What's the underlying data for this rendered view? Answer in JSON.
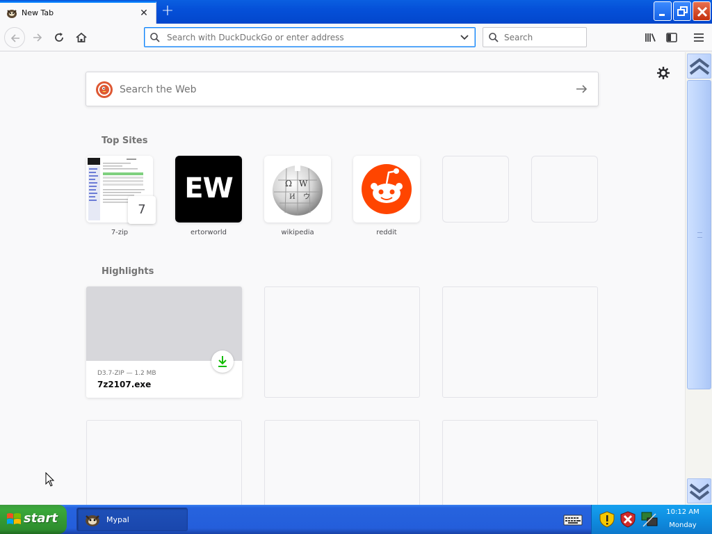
{
  "window": {
    "tab_title": "New Tab",
    "tab_close_glyph": "✕",
    "new_tab_glyph": "+"
  },
  "toolbar": {
    "url_placeholder": "Search with DuckDuckGo or enter address",
    "search_placeholder": "Search",
    "icons": [
      "back-icon",
      "forward-icon",
      "reload-icon",
      "home-icon",
      "library-icon",
      "sidebar-icon",
      "menu-icon"
    ]
  },
  "newtab": {
    "web_search_placeholder": "Search the Web",
    "top_sites_title": "Top Sites",
    "highlights_title": "Highlights",
    "top_sites": [
      {
        "label": "7-zip",
        "badge": "7"
      },
      {
        "label": "ertorworld",
        "logo_text": "EW"
      },
      {
        "label": "wikipedia"
      },
      {
        "label": "reddit"
      },
      {
        "label": ""
      },
      {
        "label": ""
      }
    ],
    "highlights": [
      {
        "meta": "D3.7-ZIP — 1.2 MB",
        "filename": "7z2107.exe"
      }
    ]
  },
  "taskbar": {
    "start_label": "start",
    "task_label": "Mypal",
    "clock_time": "10:12 AM",
    "clock_day": "Monday"
  },
  "colors": {
    "accent": "#0a84ff",
    "titlebar": "#0550d8",
    "reddit": "#ff4500",
    "duckduckgo": "#de5833",
    "download_green": "#12bc00",
    "start_green": "#3aa83a"
  }
}
